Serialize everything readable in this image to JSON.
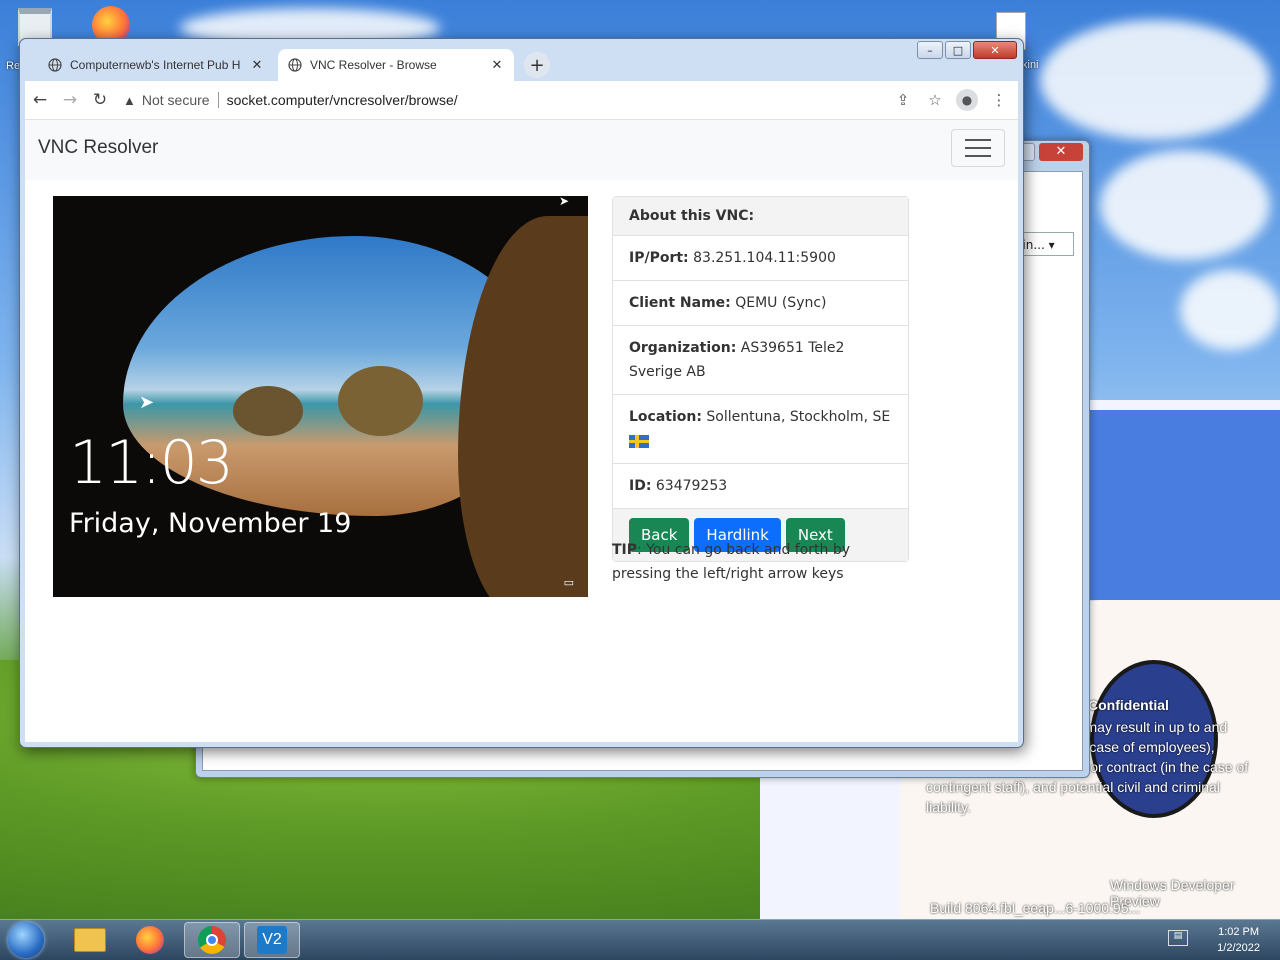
{
  "desktop": {
    "recycle_label": "Re",
    "file_label": "xini",
    "confidential_title": "Confidential",
    "confidential_text": "disclosure in any manner may result in up to and including dismissal (in the case of employees), termination of assignment or contract (in the case of contingent staff), and potential civil and criminal liability.",
    "build_line1": "Windows Developer Preview",
    "build_line2": "Build 8064.fbl_eeap...6-1000.95..."
  },
  "background_window": {
    "dropdown_text": "n in..."
  },
  "browser": {
    "tabs": [
      {
        "label": "Computernewb's Internet Pub H",
        "favicon": "globe-icon"
      },
      {
        "label": "VNC Resolver - Browse",
        "favicon": "globe-icon"
      }
    ],
    "new_tab": "+",
    "address": {
      "security": "Not secure",
      "url": "socket.computer/vncresolver/browse/"
    },
    "caption_buttons": {
      "minimize": "–",
      "maximize": "□",
      "close": "✕"
    }
  },
  "page": {
    "brand": "VNC Resolver",
    "screenshot": {
      "time": "11:03",
      "date": "Friday, November 19"
    },
    "card": {
      "header": "About this VNC:",
      "ip_label": "IP/Port:",
      "ip_value": "83.251.104.11:5900",
      "client_label": "Client Name:",
      "client_value": "QEMU (Sync)",
      "org_label": "Organization:",
      "org_value": "AS39651 Tele2 Sverige AB",
      "location_label": "Location:",
      "location_value": "Sollentuna, Stockholm, SE",
      "id_label": "ID:",
      "id_value": "63479253",
      "buttons": {
        "back": "Back",
        "hardlink": "Hardlink",
        "next": "Next"
      }
    },
    "tip": {
      "label": "TIP",
      "text": ": You can go back and forth by pressing the left/right arrow keys"
    }
  },
  "taskbar": {
    "time": "1:02 PM",
    "date": "1/2/2022",
    "vnc_label": "V2"
  }
}
